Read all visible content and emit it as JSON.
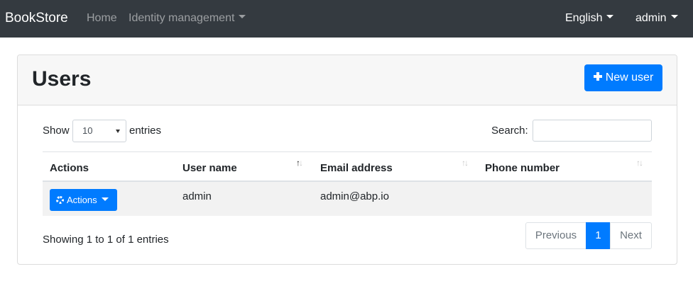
{
  "navbar": {
    "brand": "BookStore",
    "home": "Home",
    "identity_management": "Identity management",
    "language": "English",
    "user": "admin"
  },
  "card": {
    "title": "Users",
    "new_user_label": "New user"
  },
  "length": {
    "show_label": "Show",
    "selected": "10",
    "entries_label": "entries"
  },
  "search": {
    "label": "Search:",
    "value": ""
  },
  "table": {
    "columns": [
      "Actions",
      "User name",
      "Email address",
      "Phone number"
    ],
    "rows": [
      {
        "actions_label": "Actions",
        "user_name": "admin",
        "email": "admin@abp.io",
        "phone": ""
      }
    ]
  },
  "info": "Showing 1 to 1 of 1 entries",
  "pagination": {
    "previous": "Previous",
    "current": "1",
    "next": "Next"
  },
  "colors": {
    "navbar": "#343a40",
    "primary": "#007bff",
    "row_stripe": "#f2f2f2"
  }
}
